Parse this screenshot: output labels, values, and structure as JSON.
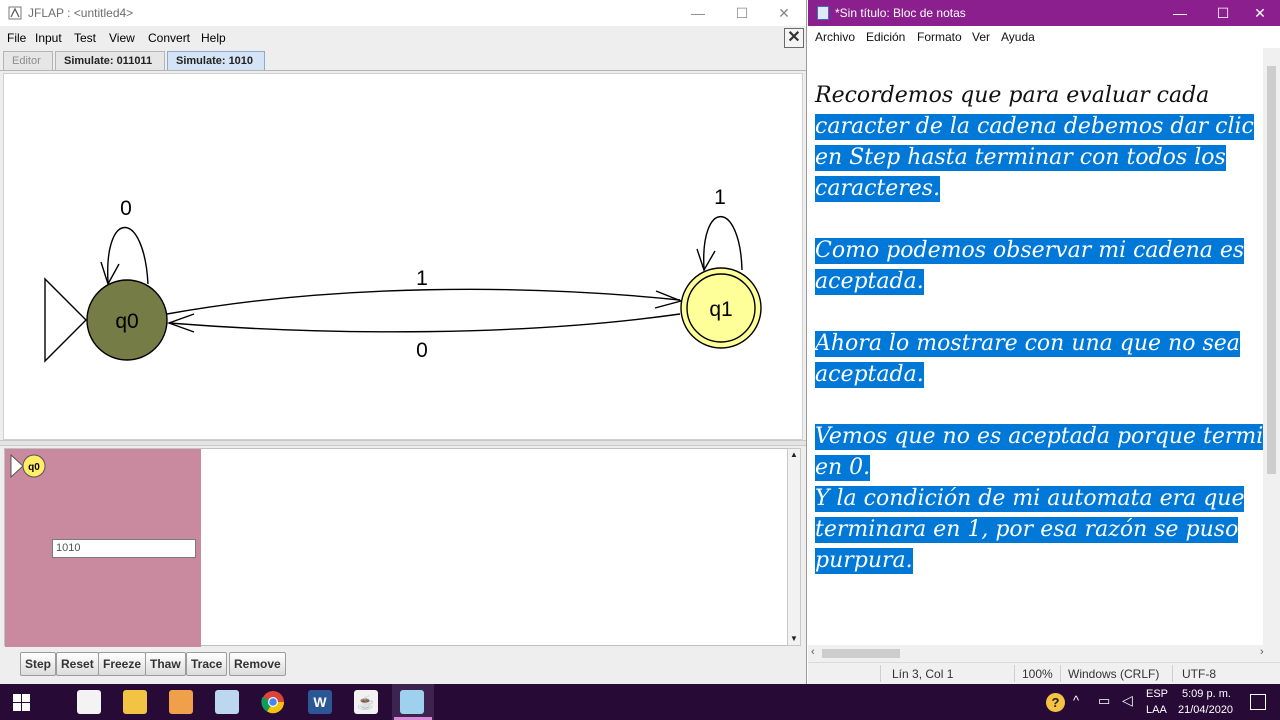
{
  "jflap": {
    "title": "JFLAP : <untitled4>",
    "menu": [
      "File",
      "Input",
      "Test",
      "View",
      "Convert",
      "Help"
    ],
    "close_doc": "✕",
    "tabs": [
      "Editor",
      "Simulate: 011011",
      "Simulate: 1010"
    ],
    "automaton": {
      "states": [
        {
          "name": "q0",
          "initial": true,
          "final": false,
          "fill": "#767c45"
        },
        {
          "name": "q1",
          "initial": false,
          "final": true,
          "fill": "#ffff99"
        }
      ],
      "transitions": [
        {
          "from": "q0",
          "to": "q0",
          "label": "0"
        },
        {
          "from": "q1",
          "to": "q1",
          "label": "1"
        },
        {
          "from": "q0",
          "to": "q1",
          "label": "1"
        },
        {
          "from": "q1",
          "to": "q0",
          "label": "0"
        }
      ]
    },
    "simulation": {
      "config_state": "q0",
      "input_value": "1010",
      "config_color": "#c98a9f"
    },
    "buttons": [
      "Step",
      "Reset",
      "Freeze",
      "Thaw",
      "Trace",
      "Remove"
    ]
  },
  "notepad": {
    "title": "*Sin título: Bloc de notas",
    "menu": [
      "Archivo",
      "Edición",
      "Formato",
      "Ver",
      "Ayuda"
    ],
    "lines": [
      {
        "text": "Recordemos que para evaluar cada",
        "selected": false
      },
      {
        "text": "caracter de la cadena debemos dar clic",
        "selected": true
      },
      {
        "text": "en Step hasta terminar con todos los",
        "selected": true
      },
      {
        "text": "caracteres.",
        "selected": true
      },
      {
        "text": "",
        "selected": false
      },
      {
        "text": "Como podemos observar mi cadena es",
        "selected": true
      },
      {
        "text": "aceptada.",
        "selected": true
      },
      {
        "text": "",
        "selected": false
      },
      {
        "text": "Ahora lo mostrare con una que no sea",
        "selected": true
      },
      {
        "text": "aceptada.",
        "selected": true
      },
      {
        "text": "",
        "selected": false
      },
      {
        "text": "Vemos que no es aceptada porque termina",
        "selected": true
      },
      {
        "text": "en 0.",
        "selected": true
      },
      {
        "text": "Y la condición de mi automata era que",
        "selected": true
      },
      {
        "text": "terminara en 1, por esa razón se puso",
        "selected": true
      },
      {
        "text": "purpura.",
        "selected": true
      }
    ],
    "status": {
      "position": "Lín 3, Col 1",
      "zoom": "100%",
      "line_endings": "Windows (CRLF)",
      "encoding": "UTF-8"
    },
    "selection_color": "#0078d7"
  },
  "taskbar": {
    "language": "ESP",
    "layout": "LAA",
    "time": "5:09 p. m.",
    "date": "21/04/2020",
    "apps": [
      "start-icon",
      "store-icon",
      "file-explorer-icon",
      "media-player-icon",
      "box-app-icon",
      "chrome-icon",
      "word-icon",
      "java-icon",
      "jflap-icon"
    ]
  }
}
